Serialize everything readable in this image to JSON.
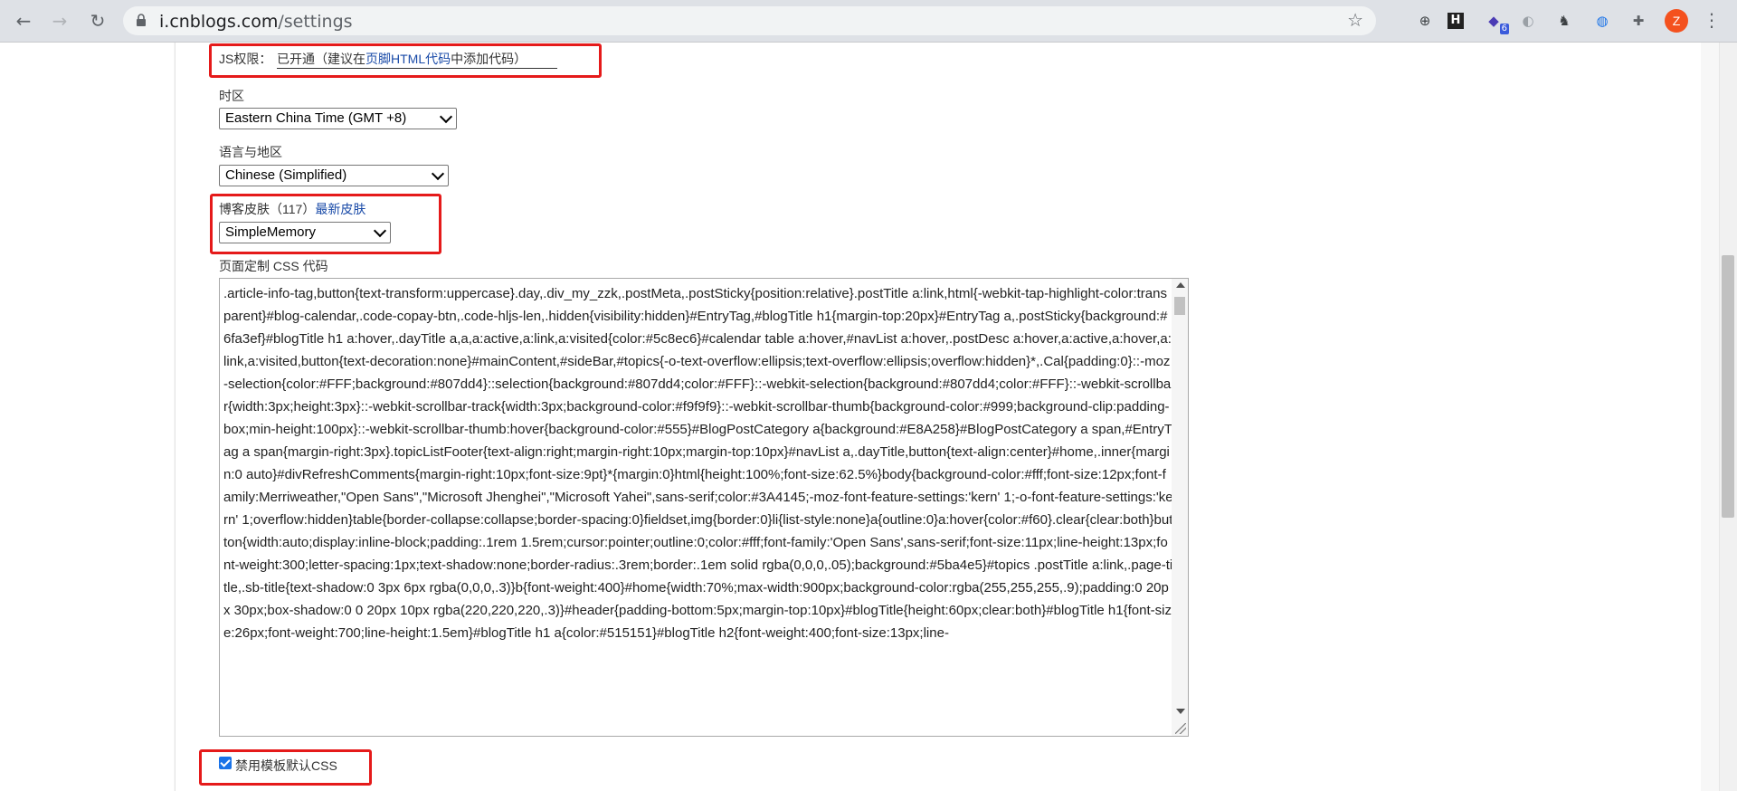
{
  "browser": {
    "url_domain": "i.cnblogs.com",
    "url_path": "/settings",
    "nav": {
      "back": "←",
      "forward": "→",
      "reload": "↻"
    },
    "star": "☆",
    "extensions": [
      {
        "glyph": "⊕",
        "badge": ""
      },
      {
        "glyph": "H",
        "badge": ""
      },
      {
        "glyph": "◆",
        "badge": "6"
      },
      {
        "glyph": "◐",
        "badge": ""
      },
      {
        "glyph": "♞",
        "badge": ""
      },
      {
        "glyph": "◍",
        "badge": ""
      },
      {
        "glyph": "✚",
        "badge": ""
      }
    ],
    "avatar": "Z",
    "menu": "⋮"
  },
  "js": {
    "label": "JS权限：",
    "value_prefix": "已开通（建议在",
    "value_link": "页脚HTML代码",
    "value_suffix": "中添加代码）"
  },
  "timezone": {
    "label": "时区",
    "selected": "Eastern China Time (GMT +8)"
  },
  "language": {
    "label": "语言与地区",
    "selected": "Chinese (Simplified)"
  },
  "skin": {
    "label": "博客皮肤（117）",
    "link": "最新皮肤",
    "selected": "SimpleMemory"
  },
  "css": {
    "label": "页面定制 CSS 代码",
    "code": ".article-info-tag,button{text-transform:uppercase}.day,.div_my_zzk,.postMeta,.postSticky{position:relative}.postTitle a:link,html{-webkit-tap-highlight-color:transparent}#blog-calendar,.code-copay-btn,.code-hljs-len,.hidden{visibility:hidden}#EntryTag,#blogTitle h1{margin-top:20px}#EntryTag a,.postSticky{background:#6fa3ef}#blogTitle h1 a:hover,.dayTitle a,a,a:active,a:link,a:visited{color:#5c8ec6}#calendar table a:hover,#navList a:hover,.postDesc a:hover,a:active,a:hover,a:link,a:visited,button{text-decoration:none}#mainContent,#sideBar,#topics{-o-text-overflow:ellipsis;text-overflow:ellipsis;overflow:hidden}*,.Cal{padding:0}::-moz-selection{color:#FFF;background:#807dd4}::selection{background:#807dd4;color:#FFF}::-webkit-selection{background:#807dd4;color:#FFF}::-webkit-scrollbar{width:3px;height:3px}::-webkit-scrollbar-track{width:3px;background-color:#f9f9f9}::-webkit-scrollbar-thumb{background-color:#999;background-clip:padding-box;min-height:100px}::-webkit-scrollbar-thumb:hover{background-color:#555}#BlogPostCategory a{background:#E8A258}#BlogPostCategory a span,#EntryTag a span{margin-right:3px}.topicListFooter{text-align:right;margin-right:10px;margin-top:10px}#navList a,.dayTitle,button{text-align:center}#home,.inner{margin:0 auto}#divRefreshComments{margin-right:10px;font-size:9pt}*{margin:0}html{height:100%;font-size:62.5%}body{background-color:#fff;font-size:12px;font-family:Merriweather,\"Open Sans\",\"Microsoft Jhenghei\",\"Microsoft Yahei\",sans-serif;color:#3A4145;-moz-font-feature-settings:'kern' 1;-o-font-feature-settings:'kern' 1;overflow:hidden}table{border-collapse:collapse;border-spacing:0}fieldset,img{border:0}li{list-style:none}a{outline:0}a:hover{color:#f60}.clear{clear:both}button{width:auto;display:inline-block;padding:.1rem 1.5rem;cursor:pointer;outline:0;color:#fff;font-family:'Open Sans',sans-serif;font-size:11px;line-height:13px;font-weight:300;letter-spacing:1px;text-shadow:none;border-radius:.3rem;border:.1em solid rgba(0,0,0,.05);background:#5ba4e5}#topics .postTitle a:link,.page-title,.sb-title{text-shadow:0 3px 6px rgba(0,0,0,.3)}b{font-weight:400}#home{width:70%;max-width:900px;background-color:rgba(255,255,255,.9);padding:0 20px 30px;box-shadow:0 0 20px 10px rgba(220,220,220,.3)}#header{padding-bottom:5px;margin-top:10px}#blogTitle{height:60px;clear:both}#blogTitle h1{font-size:26px;font-weight:700;line-height:1.5em}#blogTitle h1 a{color:#515151}#blogTitle h2{font-weight:400;font-size:13px;line-"
  },
  "disable_css": {
    "label": "禁用模板默认CSS",
    "checked": true
  }
}
